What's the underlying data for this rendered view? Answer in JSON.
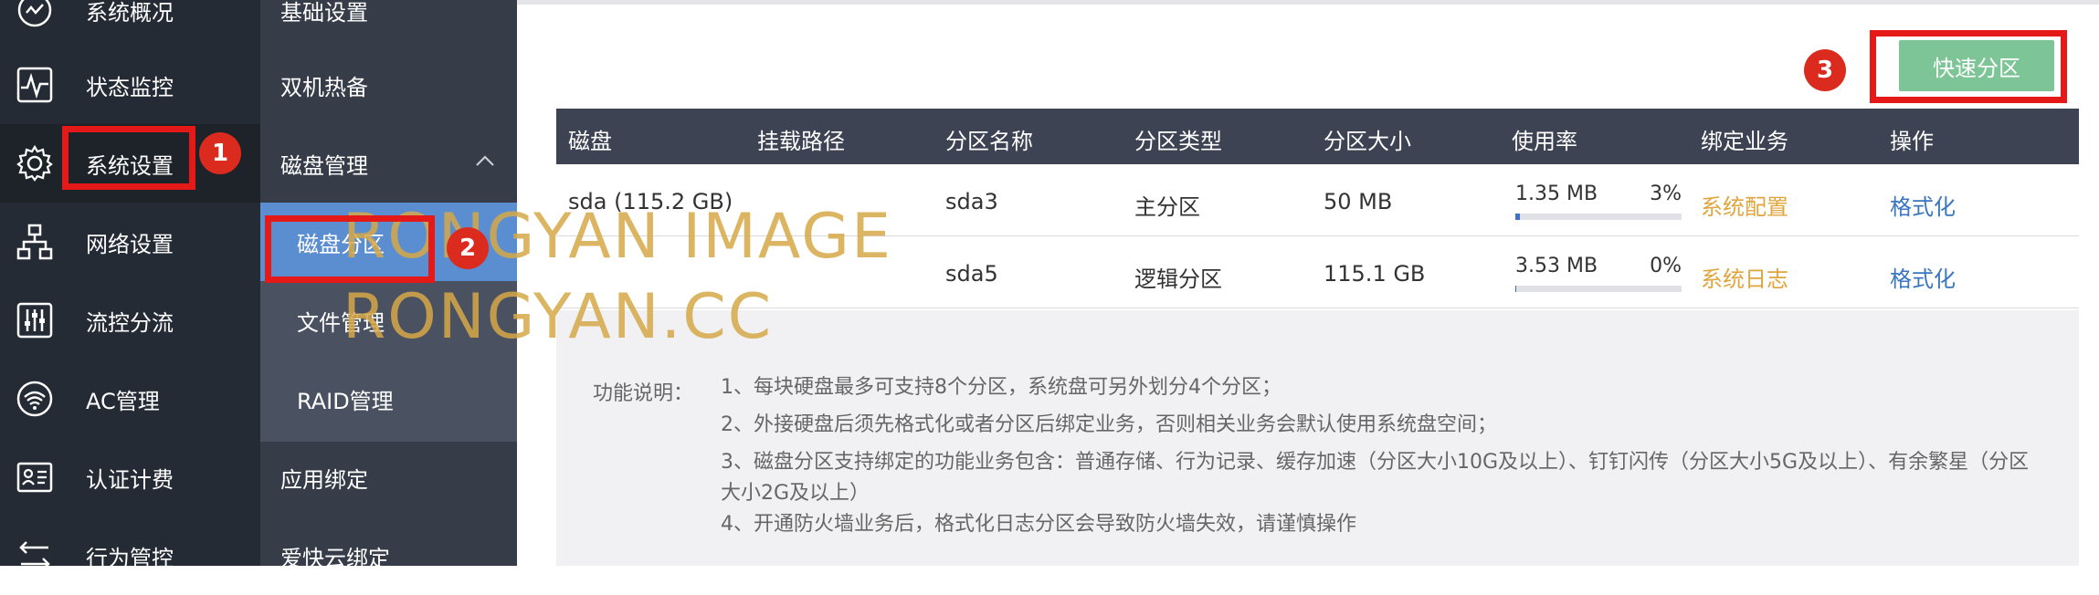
{
  "nav_primary": [
    {
      "label": "系统概况",
      "icon": "dashboard-icon"
    },
    {
      "label": "状态监控",
      "icon": "monitor-icon"
    },
    {
      "label": "系统设置",
      "icon": "gear-icon"
    },
    {
      "label": "网络设置",
      "icon": "network-icon"
    },
    {
      "label": "流控分流",
      "icon": "sliders-icon"
    },
    {
      "label": "AC管理",
      "icon": "wifi-icon"
    },
    {
      "label": "认证计费",
      "icon": "id-card-icon"
    },
    {
      "label": "行为管控",
      "icon": "arrows-icon"
    }
  ],
  "nav_secondary": [
    {
      "label": "基础设置"
    },
    {
      "label": "双机热备"
    },
    {
      "label": "磁盘管理"
    },
    {
      "label": "磁盘分区"
    },
    {
      "label": "文件管理"
    },
    {
      "label": "RAID管理"
    },
    {
      "label": "应用绑定"
    },
    {
      "label": "爱快云绑定"
    }
  ],
  "toolbar": {
    "quick_partition_label": "快速分区"
  },
  "table": {
    "headers": [
      "磁盘",
      "挂载路径",
      "分区名称",
      "分区类型",
      "分区大小",
      "使用率",
      "绑定业务",
      "操作"
    ],
    "rows": [
      {
        "disk": "sda (115.2 GB)",
        "mount": "",
        "name": "sda3",
        "type": "主分区",
        "size": "50 MB",
        "used": "1.35 MB",
        "pct": "3%",
        "pct_value": 3,
        "binding": "系统配置",
        "action": "格式化"
      },
      {
        "disk": "",
        "mount": "",
        "name": "sda5",
        "type": "逻辑分区",
        "size": "115.1 GB",
        "used": "3.53 MB",
        "pct": "0%",
        "pct_value": 0,
        "binding": "系统日志",
        "action": "格式化"
      }
    ]
  },
  "description": {
    "title": "功能说明：",
    "lines": [
      "1、每块硬盘最多可支持8个分区，系统盘可另外划分4个分区；",
      "2、外接硬盘后须先格式化或者分区后绑定业务，否则相关业务会默认使用系统盘空间；",
      "3、磁盘分区支持绑定的功能业务包含：普通存储、行为记录、缓存加速（分区大小10G及以上）、钉钉闪传（分区大小5G及以上）、有余繁星（分区大小2G及以上）",
      "4、开通防火墙业务后，格式化日志分区会导致防火墙失效，请谨慎操作"
    ]
  },
  "annotations": {
    "badge1": "1",
    "badge2": "2",
    "badge3": "3"
  },
  "watermark": {
    "line1": "RONGYAN IMAGE",
    "line2": "RONGYAN.CC"
  },
  "colors": {
    "accent_green": "#7dc496",
    "selected_blue": "#5b8ed0",
    "binding_orange": "#e0a53c",
    "link_blue": "#3a76c0",
    "annotation_red": "#e61919"
  }
}
